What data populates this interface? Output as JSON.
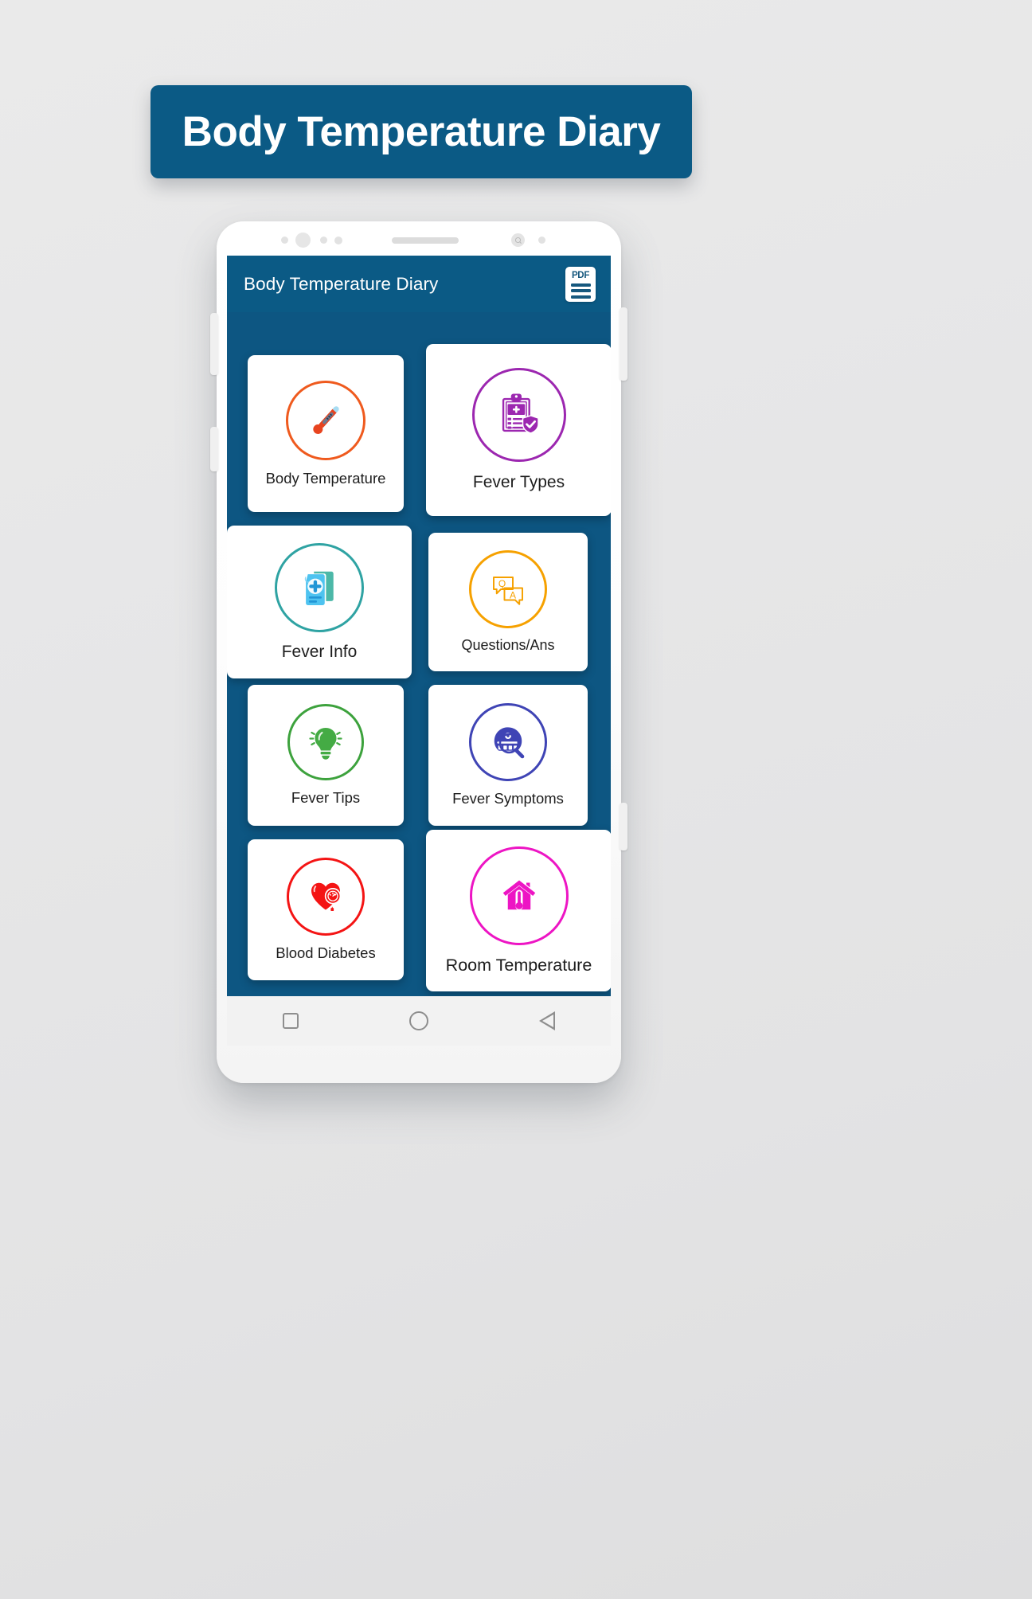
{
  "banner": {
    "title": "Body Temperature Diary",
    "background_color": "#0b5a85",
    "text_color": "#ffffff"
  },
  "phone": {
    "screen_background_color": "#0d5682",
    "app_bar": {
      "title": "Body Temperature Diary",
      "background_color": "#0b5a85",
      "action_icon": "pdf-icon",
      "action_label": "PDF"
    },
    "nav_bar": {
      "buttons": [
        "recents-square",
        "home-circle",
        "back-triangle"
      ]
    }
  },
  "tiles": [
    {
      "label": "Body Temperature",
      "icon": "thermometer-icon",
      "accent_color": "#ef5a1e"
    },
    {
      "label": "Fever Types",
      "icon": "clipboard-shield-icon",
      "accent_color": "#9c27b0"
    },
    {
      "label": "Fever Info",
      "icon": "medical-document-icon",
      "accent_color": "#2fa3a3"
    },
    {
      "label": "Questions/Ans",
      "icon": "qa-speech-bubbles-icon",
      "accent_color": "#f6a100"
    },
    {
      "label": "Fever Tips",
      "icon": "lightbulb-icon",
      "accent_color": "#3da23d"
    },
    {
      "label": "Fever Symptoms",
      "icon": "head-magnifier-icon",
      "accent_color": "#3f44b5"
    },
    {
      "label": "Blood Diabetes",
      "icon": "heart-gauge-icon",
      "accent_color": "#f41414"
    },
    {
      "label": "Room Temperature",
      "icon": "house-thermometer-icon",
      "accent_color": "#ed15c4"
    }
  ]
}
